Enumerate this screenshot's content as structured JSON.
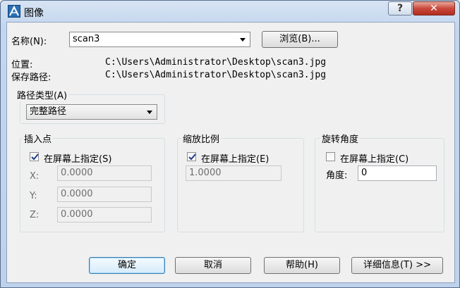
{
  "window": {
    "title": "图像",
    "help_glyph": "?",
    "close_glyph": "✕"
  },
  "name_row": {
    "label": "名称(N):",
    "value": "scan3",
    "browse_label": "浏览(B)..."
  },
  "paths": {
    "location_label": "位置:",
    "location_value": "C:\\Users\\Administrator\\Desktop\\scan3.jpg",
    "saved_label": "保存路径:",
    "saved_value": "C:\\Users\\Administrator\\Desktop\\scan3.jpg"
  },
  "path_type": {
    "title": "路径类型(A)",
    "value": "完整路径"
  },
  "insertion": {
    "title": "插入点",
    "checkbox_label": "在屏幕上指定(S)",
    "checked": true,
    "x_label": "X:",
    "x_value": "0.0000",
    "y_label": "Y:",
    "y_value": "0.0000",
    "z_label": "Z:",
    "z_value": "0.0000"
  },
  "scale": {
    "title": "缩放比例",
    "checkbox_label": "在屏幕上指定(E)",
    "checked": true,
    "value": "1.0000"
  },
  "rotation": {
    "title": "旋转角度",
    "checkbox_label": "在屏幕上指定(C)",
    "checked": false,
    "angle_label": "角度:",
    "angle_value": "0"
  },
  "buttons": {
    "ok": "确定",
    "cancel": "取消",
    "help": "帮助(H)",
    "details": "详细信息(T) >>"
  },
  "colors": {
    "title_bar": "#c3d6ee",
    "close_button": "#c9483a",
    "default_button_border": "#3c7fb1"
  }
}
